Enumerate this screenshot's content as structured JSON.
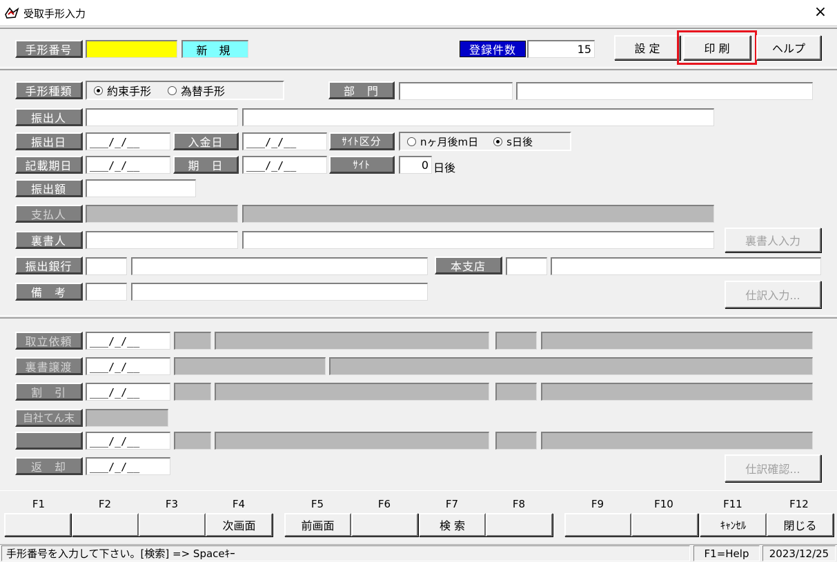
{
  "window": {
    "title": "受取手形入力",
    "close_icon": "×"
  },
  "header": {
    "note_number_label": "手形番号",
    "note_number_value": "",
    "mode": "新 規",
    "registered_count_label": "登録件数",
    "registered_count_value": "15",
    "settings_button": "設 定",
    "print_button": "印 刷",
    "help_button": "ヘルプ"
  },
  "main": {
    "note_type_label": "手形種類",
    "note_type_options": [
      {
        "label": "約束手形",
        "selected": true
      },
      {
        "label": "為替手形",
        "selected": false
      }
    ],
    "department_label": "部　門",
    "drawer_label": "振出人",
    "issue_date_label": "振出日",
    "deposit_date_label": "入金日",
    "site_type_label": "ｻｲﾄ区分",
    "site_type_options": [
      {
        "label": "nヶ月後m日",
        "selected": false
      },
      {
        "label": "s日後",
        "selected": true
      }
    ],
    "entry_due_label": "記載期日",
    "due_date_label": "期　日",
    "site_label": "ｻｲﾄ",
    "site_value": "0",
    "site_unit": "日後",
    "amount_label": "振出額",
    "payer_label": "支払人",
    "endorser_label": "裏書人",
    "endorser_input_button": "裏書人入力",
    "issuing_bank_label": "振出銀行",
    "branch_label": "本支店",
    "remarks_label": "備　考",
    "journal_input_button": "仕訳入力..."
  },
  "processing": {
    "collection_label": "取立依頼",
    "transfer_label": "裏書譲渡",
    "discount_label": "割　引",
    "self_settle_label": "自社てん末",
    "blank_label": "",
    "return_label": "返　却",
    "journal_confirm_button": "仕訳確認..."
  },
  "date_placeholder": "___/_/__",
  "function_keys": [
    {
      "key": "F1",
      "label": ""
    },
    {
      "key": "F2",
      "label": ""
    },
    {
      "key": "F3",
      "label": ""
    },
    {
      "key": "F4",
      "label": "次画面"
    },
    {
      "key": "F5",
      "label": "前画面"
    },
    {
      "key": "F6",
      "label": ""
    },
    {
      "key": "F7",
      "label": "検 索"
    },
    {
      "key": "F8",
      "label": ""
    },
    {
      "key": "F9",
      "label": ""
    },
    {
      "key": "F10",
      "label": ""
    },
    {
      "key": "F11",
      "label": "ｷｬﾝｾﾙ"
    },
    {
      "key": "F12",
      "label": "閉じる"
    }
  ],
  "status_bar": {
    "message": "手形番号を入力して下さい。[検索] => Spaceｷｰ",
    "help_hint": "F1=Help",
    "date": "2023/12/25"
  },
  "colors": {
    "highlight": "#e8141e",
    "yellow": "#ffff00",
    "cyan": "#80ffff",
    "blue": "#0000c8"
  }
}
